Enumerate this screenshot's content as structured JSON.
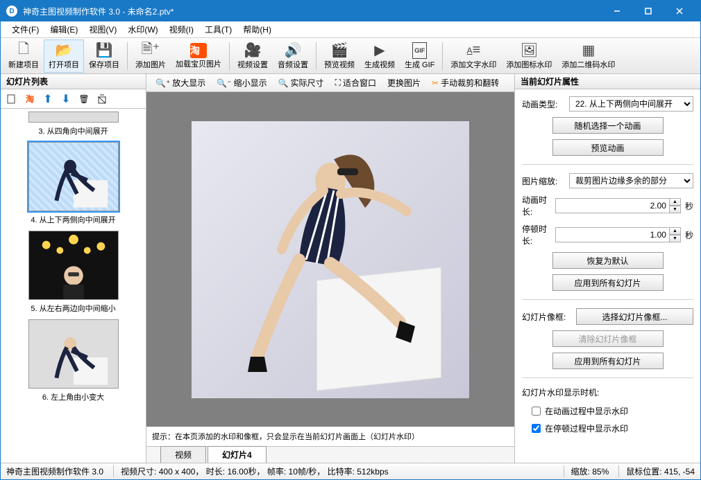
{
  "window": {
    "title": "神奇主图视频制作软件 3.0 - 未命名2.ptv*"
  },
  "menu": {
    "file": "文件(F)",
    "edit": "编辑(E)",
    "view": "视图(V)",
    "watermark": "水印(W)",
    "video": "视频(I)",
    "tools": "工具(T)",
    "help": "帮助(H)"
  },
  "toolbar": {
    "new": "新建项目",
    "open": "打开项目",
    "save": "保存项目",
    "addimg": "添加图片",
    "addtbimg": "加载宝贝图片",
    "videoset": "视频设置",
    "audioset": "音频设置",
    "preview": "预览视频",
    "genvideo": "生成视频",
    "gengif": "生成 GIF",
    "textwm": "添加文字水印",
    "iconwm": "添加图标水印",
    "qrwm": "添加二维码水印"
  },
  "sidebar": {
    "title": "幻灯片列表",
    "items": [
      {
        "label": "3. 从四角向中间展开"
      },
      {
        "label": "4. 从上下两侧向中间展开"
      },
      {
        "label": "5. 从左右两边向中间缩小"
      },
      {
        "label": "6. 左上角由小变大"
      }
    ]
  },
  "viewtb": {
    "zoomin": "放大显示",
    "zoomout": "缩小显示",
    "actual": "实际尺寸",
    "fit": "适合窗口",
    "replace": "更换图片",
    "crop": "手动裁剪和翻转"
  },
  "hint": "提示：在本页添加的水印和像框，只会显示在当前幻灯片画面上（幻灯片水印）",
  "tabs": {
    "video": "视频",
    "slide": "幻灯片4"
  },
  "props": {
    "title": "当前幻灯片属性",
    "animtype_label": "动画类型:",
    "animtype_value": "22. 从上下两侧向中间展开",
    "randbtn": "随机选择一个动画",
    "previewbtn": "预览动画",
    "imgscale_label": "图片缩放:",
    "imgscale_value": "裁剪图片边缘多余的部分",
    "animdur_label": "动画时长:",
    "animdur_value": "2.00",
    "sec": "秒",
    "pausedur_label": "停顿时长:",
    "pausedur_value": "1.00",
    "resetbtn": "恢复为默认",
    "applyallbtn": "应用到所有幻灯片",
    "frame_label": "幻灯片像框:",
    "selframebtn": "选择幻灯片像框...",
    "clearframebtn": "清除幻灯片像框",
    "applyallframebtn": "应用到所有幻灯片",
    "wmtiming_label": "幻灯片水印显示时机:",
    "cb_anim": "在动画过程中显示水印",
    "cb_pause": "在停顿过程中显示水印"
  },
  "status": {
    "app": "神奇主图视频制作软件 3.0",
    "dim_l": "视频尺寸:",
    "dim_v": "400 x 400，",
    "dur_l": "时长:",
    "dur_v": "16.00秒，",
    "fps_l": "帧率:",
    "fps_v": "10帧/秒，",
    "bitrate_l": "比特率:",
    "bitrate_v": "512kbps",
    "zoom_l": "缩放:",
    "zoom_v": "85%",
    "mouse_l": "鼠标位置:",
    "mouse_v": "415, -54"
  }
}
